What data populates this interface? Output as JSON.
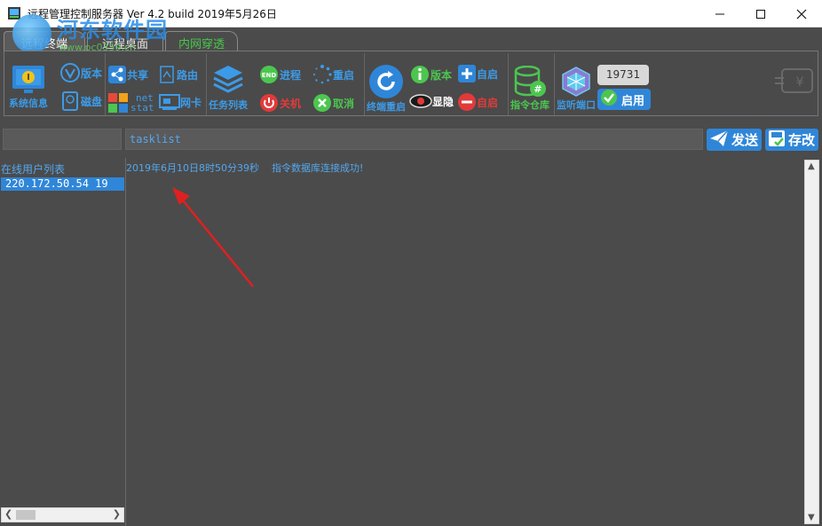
{
  "window": {
    "title": "远程管理控制服务器 Ver 4.2 build 2019年5月26日",
    "minimize_label": "—",
    "maximize_label": "☐",
    "close_label": "✕"
  },
  "watermark": {
    "text": "河东软件园",
    "url": "www.pc0359.cn"
  },
  "tabs": [
    {
      "label": "远程终端",
      "active": true
    },
    {
      "label": "远程桌面",
      "active": false
    },
    {
      "label": "内网穿透",
      "active": false
    }
  ],
  "toolbar": {
    "system_info": "系统信息",
    "version": "版本",
    "disk": "磁盘",
    "share": "共享",
    "route": "路由",
    "netstat_line1": "net",
    "netstat_line2": "stat",
    "nic": "网卡",
    "task_list": "任务列表",
    "process": "进程",
    "restart": "重启",
    "shutdown": "关机",
    "cancel": "取消",
    "terminal_restart": "终端重启",
    "client_version": "版本",
    "autostart_add": "自启",
    "show_hide": "显隐",
    "autostart_remove": "自启",
    "command_repo": "指令仓库",
    "listen_port": "监听端口",
    "port_value": "19731",
    "enable": "启用",
    "end_icon_text": "END"
  },
  "command": {
    "user_field": "",
    "command_value": "tasklist",
    "send_label": "发送",
    "save_label": "存改"
  },
  "users": {
    "header": "在线用户列表",
    "items": [
      "220.172.50.54     19"
    ]
  },
  "log": {
    "lines": [
      {
        "time": "2019年6月10日8时50分39秒",
        "message": "指令数据库连接成功!"
      }
    ]
  },
  "colors": {
    "accent_blue": "#2f86d8",
    "text_blue": "#55a7ee",
    "green": "#4cc64f",
    "red": "#e23a3a",
    "background": "#4b4b4b"
  }
}
